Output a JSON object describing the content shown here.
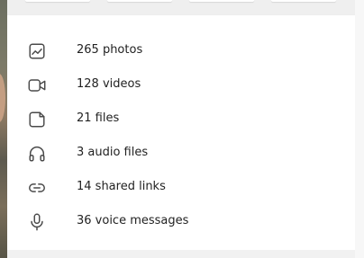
{
  "theme": {
    "icon_color": "#4a4a4a",
    "text_color": "#222222",
    "panel_bg": "#ffffff"
  },
  "media_summary": {
    "items": [
      {
        "icon": "photo-icon",
        "label": "265 photos"
      },
      {
        "icon": "video-icon",
        "label": "128 videos"
      },
      {
        "icon": "file-icon",
        "label": "21 files"
      },
      {
        "icon": "headphones-icon",
        "label": "3 audio files"
      },
      {
        "icon": "link-icon",
        "label": "14 shared links"
      },
      {
        "icon": "microphone-icon",
        "label": "36 voice messages"
      }
    ]
  }
}
